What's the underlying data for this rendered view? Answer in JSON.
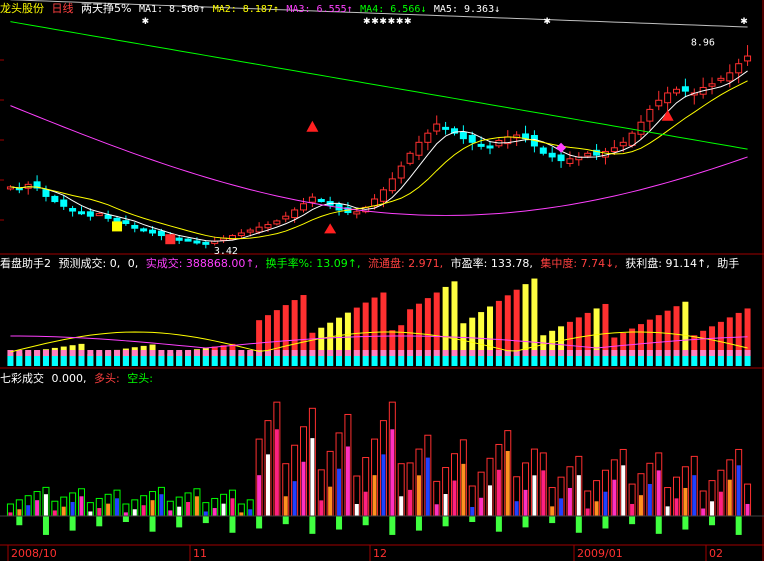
{
  "header": {
    "stock_name": "龙头股份",
    "period": "日线",
    "formula": "两天挣5%",
    "ma_items": [
      {
        "label": "MA1: 8.560↑",
        "color": "#ffffff"
      },
      {
        "label": "MA2: 8.187↑",
        "color": "#ffff00"
      },
      {
        "label": "MA3: 6.555↑",
        "color": "#ff40ff"
      },
      {
        "label": "MA4: 6.566↓",
        "color": "#00ff00"
      },
      {
        "label": "MA5: 9.363↓",
        "color": "#ffffff"
      }
    ]
  },
  "price_panel": {
    "high_label": "8.96",
    "low_label": "3.42"
  },
  "indicator_panel": {
    "title": "看盘助手2",
    "items": [
      {
        "label": "预测成交: 0,",
        "color": "#ffffff"
      },
      {
        "label": "0,",
        "color": "#ffffff"
      },
      {
        "label": "实成交: 388868.00↑,",
        "color": "#ff40ff"
      },
      {
        "label": "换手率%: 13.09↑,",
        "color": "#00ff00"
      },
      {
        "label": "流通盘: 2.971,",
        "color": "#ff4040"
      },
      {
        "label": "市盈率: 133.78,",
        "color": "#ffffff"
      },
      {
        "label": "集中度: 7.74↓,",
        "color": "#ff4040"
      },
      {
        "label": "获利盘: 91.14↑,",
        "color": "#ffffff"
      },
      {
        "label": "助手",
        "color": "#ffffff"
      }
    ]
  },
  "volume_panel": {
    "title": "七彩成交",
    "value": "0.000,",
    "bull_label": "多头:",
    "bear_label": "空头:"
  },
  "x_axis": {
    "labels": [
      "2008/10",
      "11",
      "12",
      "2009/01",
      "02"
    ]
  },
  "colors": {
    "up": "#ff3030",
    "down": "#00ffff",
    "ma_white": "#ffffff",
    "ma_yellow": "#ffff00",
    "ma_magenta": "#ff40ff",
    "ma_green": "#00ff00",
    "grid": "#800000"
  },
  "chart_data": {
    "type": "candlestick",
    "title": "",
    "x_labels": [
      "2008/10",
      "11",
      "12",
      "2009/01",
      "02"
    ],
    "close": [
      4.98,
      4.92,
      5.05,
      4.95,
      4.72,
      4.58,
      4.45,
      4.32,
      4.28,
      4.18,
      4.25,
      4.12,
      4.02,
      3.98,
      3.85,
      3.78,
      3.72,
      3.65,
      3.58,
      3.52,
      3.55,
      3.48,
      3.42,
      3.5,
      3.58,
      3.65,
      3.72,
      3.8,
      3.88,
      3.95,
      4.05,
      4.18,
      4.35,
      4.52,
      4.7,
      4.6,
      4.48,
      4.35,
      4.28,
      4.3,
      4.42,
      4.65,
      4.9,
      5.2,
      5.55,
      5.9,
      6.2,
      6.45,
      6.7,
      6.6,
      6.45,
      6.3,
      6.2,
      6.1,
      6.05,
      6.25,
      6.35,
      6.4,
      6.3,
      6.1,
      5.9,
      5.8,
      5.7,
      5.75,
      5.8,
      5.9,
      5.85,
      5.95,
      6.05,
      6.2,
      6.45,
      6.75,
      7.1,
      7.35,
      7.55,
      7.65,
      7.6,
      7.55,
      7.7,
      7.8,
      7.95,
      8.1,
      8.35,
      8.56
    ]
  }
}
